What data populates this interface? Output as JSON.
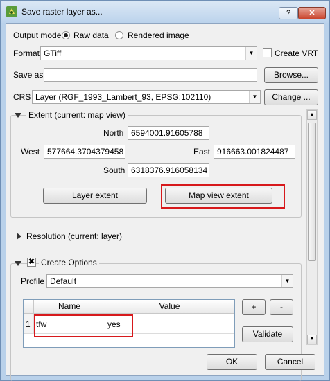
{
  "window": {
    "title": "Save raster layer as...",
    "help_label": "?",
    "close_label": "✕"
  },
  "output_mode": {
    "label": "Output mode",
    "raw": "Raw data",
    "rendered": "Rendered image"
  },
  "format": {
    "label": "Format",
    "value": "GTiff",
    "vrt_label": "Create VRT"
  },
  "save_as": {
    "label": "Save as",
    "value": "",
    "browse_label": "Browse..."
  },
  "crs": {
    "label": "CRS",
    "value": "Layer (RGF_1993_Lambert_93, EPSG:102110)",
    "change_label": "Change ..."
  },
  "extent": {
    "title": "Extent (current: map view)",
    "north_label": "North",
    "north": "6594001.91605788",
    "west_label": "West",
    "west": "577664.3704379458",
    "east_label": "East",
    "east": "916663.001824487",
    "south_label": "South",
    "south": "6318376.916058134",
    "layer_extent_label": "Layer extent",
    "map_view_extent_label": "Map view extent"
  },
  "resolution": {
    "title": "Resolution (current: layer)"
  },
  "create_options": {
    "title": "Create Options",
    "profile_label": "Profile",
    "profile_value": "Default",
    "columns": [
      "Name",
      "Value"
    ],
    "rows": [
      {
        "num": "1",
        "name": "tfw",
        "value": "yes"
      }
    ],
    "add_label": "+",
    "remove_label": "-",
    "validate_label": "Validate"
  },
  "footer": {
    "ok_label": "OK",
    "cancel_label": "Cancel"
  },
  "colors": {
    "highlight": "#d7191c",
    "frame": "#b9d1ea"
  }
}
